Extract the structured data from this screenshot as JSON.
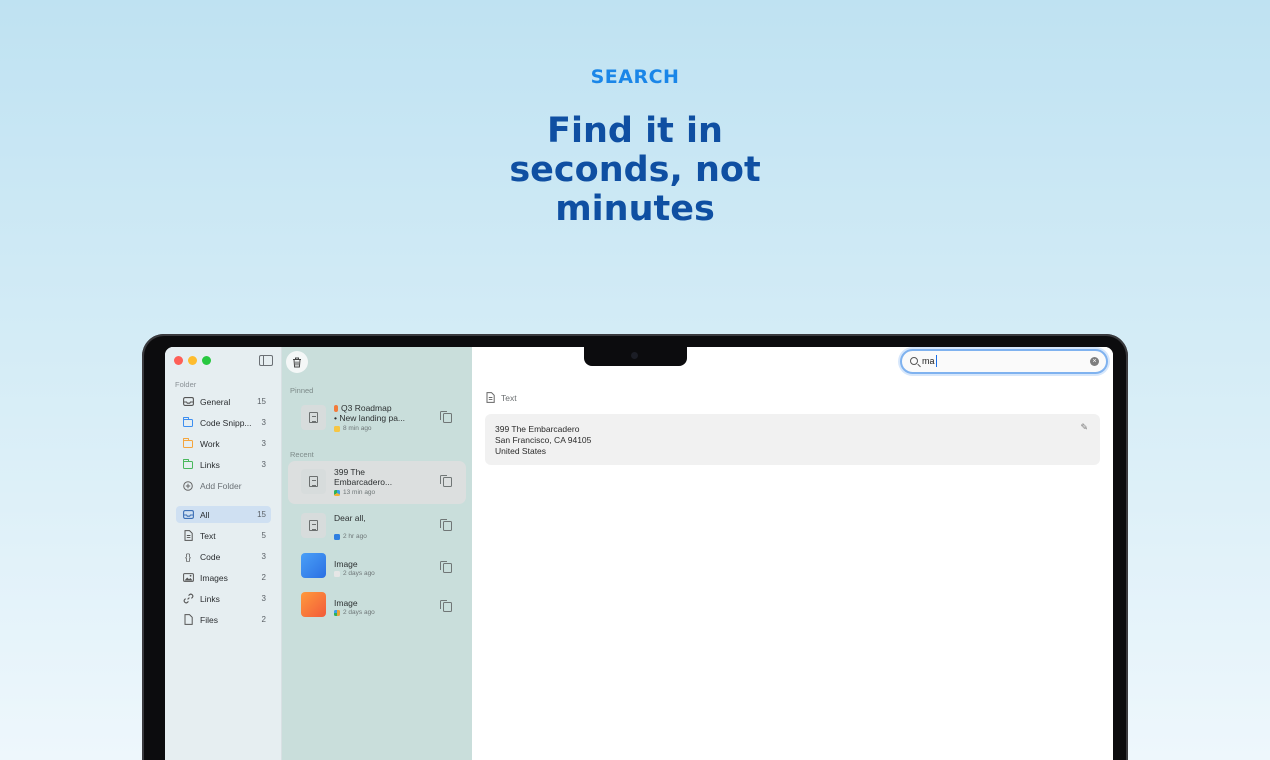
{
  "hero": {
    "eyebrow": "SEARCH",
    "headline": [
      "Find it in",
      "seconds, not",
      "minutes"
    ]
  },
  "sidebar": {
    "folder_section": "Folder",
    "folders": [
      {
        "label": "General",
        "count": "15",
        "icon": "tray-icon"
      },
      {
        "label": "Code Snipp...",
        "count": "3",
        "icon": "folder-icon",
        "color": "#3d8ef0"
      },
      {
        "label": "Work",
        "count": "3",
        "icon": "folder-icon",
        "color": "#f5a53c"
      },
      {
        "label": "Links",
        "count": "3",
        "icon": "folder-icon",
        "color": "#49b85c"
      }
    ],
    "add_folder": "Add Folder",
    "types": [
      {
        "label": "All",
        "count": "15",
        "active": true,
        "icon": "tray-icon"
      },
      {
        "label": "Text",
        "count": "5",
        "icon": "document-icon"
      },
      {
        "label": "Code",
        "count": "3",
        "icon": "braces-icon"
      },
      {
        "label": "Images",
        "count": "2",
        "icon": "image-icon"
      },
      {
        "label": "Links",
        "count": "3",
        "icon": "link-icon"
      },
      {
        "label": "Files",
        "count": "2",
        "icon": "file-icon"
      }
    ]
  },
  "list": {
    "pinned_label": "Pinned",
    "recent_label": "Recent",
    "pinned": [
      {
        "title_line1": "Q3 Roadmap",
        "title_line2": "• New landing pa...",
        "time": "8 min ago",
        "source_color": "#f6c644"
      }
    ],
    "recent": [
      {
        "title_line1": "399 The",
        "title_line2": "Embarcadero...",
        "time": "13 min ago",
        "source_color": "#3aa0e8",
        "selected": true
      },
      {
        "title_line1": "Dear all,",
        "title_line2": "",
        "time": "2 hr ago",
        "source_color": "#2f7fe0"
      },
      {
        "title_line1": "Image",
        "title_line2": "",
        "time": "2 days ago",
        "source_color": "#d9d9d9",
        "thumb": "blue"
      },
      {
        "title_line1": "Image",
        "title_line2": "",
        "time": "2 days ago",
        "source_color": "#e8a33c",
        "thumb": "orange"
      }
    ]
  },
  "search": {
    "value": "ma"
  },
  "detail": {
    "type_label": "Text",
    "lines": [
      "399 The Embarcadero",
      "San Francisco, CA 94105",
      "United States"
    ]
  }
}
